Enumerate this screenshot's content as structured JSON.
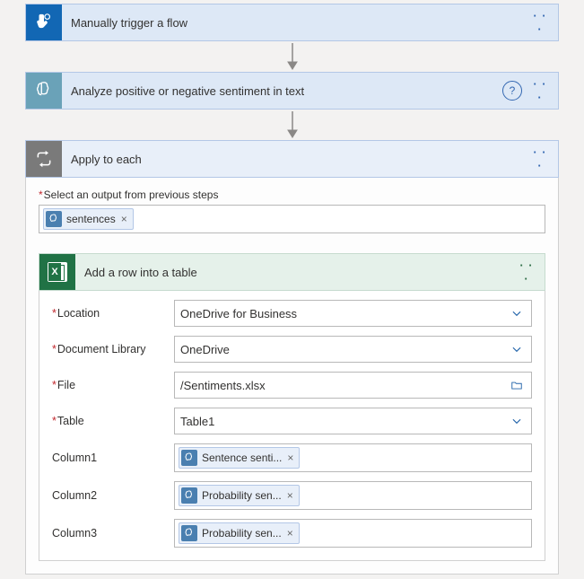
{
  "step1": {
    "title": "Manually trigger a flow",
    "icon": "tap-icon"
  },
  "step2": {
    "title": "Analyze positive or negative sentiment in text",
    "icon": "brain-icon"
  },
  "applyEach": {
    "title": "Apply to each",
    "icon": "loop-icon",
    "hint_label": "Select an output from previous steps",
    "output_token": "sentences"
  },
  "excel": {
    "title": "Add a row into a table",
    "icon": "excel-icon",
    "rows": {
      "location": {
        "label": "Location",
        "required": true,
        "value": "OneDrive for Business",
        "action": "dropdown"
      },
      "library": {
        "label": "Document Library",
        "required": true,
        "value": "OneDrive",
        "action": "dropdown"
      },
      "file": {
        "label": "File",
        "required": true,
        "value": "/Sentiments.xlsx",
        "action": "file"
      },
      "table": {
        "label": "Table",
        "required": true,
        "value": "Table1",
        "action": "dropdown"
      },
      "c1": {
        "label": "Column1",
        "required": false,
        "token": "Sentence senti..."
      },
      "c2": {
        "label": "Column2",
        "required": false,
        "token": "Probability sen..."
      },
      "c3": {
        "label": "Column3",
        "required": false,
        "token": "Probability sen..."
      }
    }
  }
}
